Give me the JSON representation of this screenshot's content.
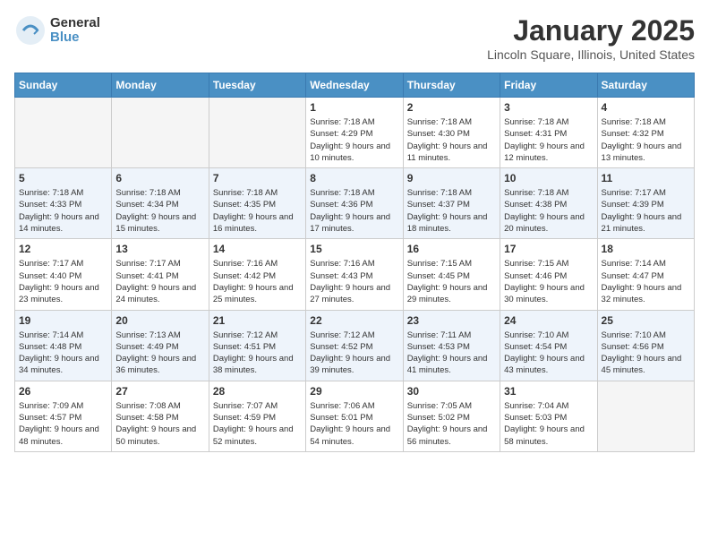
{
  "header": {
    "logo_general": "General",
    "logo_blue": "Blue",
    "month_title": "January 2025",
    "location": "Lincoln Square, Illinois, United States"
  },
  "weekdays": [
    "Sunday",
    "Monday",
    "Tuesday",
    "Wednesday",
    "Thursday",
    "Friday",
    "Saturday"
  ],
  "weeks": [
    {
      "alt": false,
      "days": [
        {
          "empty": true
        },
        {
          "empty": true
        },
        {
          "empty": true
        },
        {
          "num": "1",
          "sunrise": "7:18 AM",
          "sunset": "4:29 PM",
          "daylight": "9 hours and 10 minutes."
        },
        {
          "num": "2",
          "sunrise": "7:18 AM",
          "sunset": "4:30 PM",
          "daylight": "9 hours and 11 minutes."
        },
        {
          "num": "3",
          "sunrise": "7:18 AM",
          "sunset": "4:31 PM",
          "daylight": "9 hours and 12 minutes."
        },
        {
          "num": "4",
          "sunrise": "7:18 AM",
          "sunset": "4:32 PM",
          "daylight": "9 hours and 13 minutes."
        }
      ]
    },
    {
      "alt": true,
      "days": [
        {
          "num": "5",
          "sunrise": "7:18 AM",
          "sunset": "4:33 PM",
          "daylight": "9 hours and 14 minutes."
        },
        {
          "num": "6",
          "sunrise": "7:18 AM",
          "sunset": "4:34 PM",
          "daylight": "9 hours and 15 minutes."
        },
        {
          "num": "7",
          "sunrise": "7:18 AM",
          "sunset": "4:35 PM",
          "daylight": "9 hours and 16 minutes."
        },
        {
          "num": "8",
          "sunrise": "7:18 AM",
          "sunset": "4:36 PM",
          "daylight": "9 hours and 17 minutes."
        },
        {
          "num": "9",
          "sunrise": "7:18 AM",
          "sunset": "4:37 PM",
          "daylight": "9 hours and 18 minutes."
        },
        {
          "num": "10",
          "sunrise": "7:18 AM",
          "sunset": "4:38 PM",
          "daylight": "9 hours and 20 minutes."
        },
        {
          "num": "11",
          "sunrise": "7:17 AM",
          "sunset": "4:39 PM",
          "daylight": "9 hours and 21 minutes."
        }
      ]
    },
    {
      "alt": false,
      "days": [
        {
          "num": "12",
          "sunrise": "7:17 AM",
          "sunset": "4:40 PM",
          "daylight": "9 hours and 23 minutes."
        },
        {
          "num": "13",
          "sunrise": "7:17 AM",
          "sunset": "4:41 PM",
          "daylight": "9 hours and 24 minutes."
        },
        {
          "num": "14",
          "sunrise": "7:16 AM",
          "sunset": "4:42 PM",
          "daylight": "9 hours and 25 minutes."
        },
        {
          "num": "15",
          "sunrise": "7:16 AM",
          "sunset": "4:43 PM",
          "daylight": "9 hours and 27 minutes."
        },
        {
          "num": "16",
          "sunrise": "7:15 AM",
          "sunset": "4:45 PM",
          "daylight": "9 hours and 29 minutes."
        },
        {
          "num": "17",
          "sunrise": "7:15 AM",
          "sunset": "4:46 PM",
          "daylight": "9 hours and 30 minutes."
        },
        {
          "num": "18",
          "sunrise": "7:14 AM",
          "sunset": "4:47 PM",
          "daylight": "9 hours and 32 minutes."
        }
      ]
    },
    {
      "alt": true,
      "days": [
        {
          "num": "19",
          "sunrise": "7:14 AM",
          "sunset": "4:48 PM",
          "daylight": "9 hours and 34 minutes."
        },
        {
          "num": "20",
          "sunrise": "7:13 AM",
          "sunset": "4:49 PM",
          "daylight": "9 hours and 36 minutes."
        },
        {
          "num": "21",
          "sunrise": "7:12 AM",
          "sunset": "4:51 PM",
          "daylight": "9 hours and 38 minutes."
        },
        {
          "num": "22",
          "sunrise": "7:12 AM",
          "sunset": "4:52 PM",
          "daylight": "9 hours and 39 minutes."
        },
        {
          "num": "23",
          "sunrise": "7:11 AM",
          "sunset": "4:53 PM",
          "daylight": "9 hours and 41 minutes."
        },
        {
          "num": "24",
          "sunrise": "7:10 AM",
          "sunset": "4:54 PM",
          "daylight": "9 hours and 43 minutes."
        },
        {
          "num": "25",
          "sunrise": "7:10 AM",
          "sunset": "4:56 PM",
          "daylight": "9 hours and 45 minutes."
        }
      ]
    },
    {
      "alt": false,
      "days": [
        {
          "num": "26",
          "sunrise": "7:09 AM",
          "sunset": "4:57 PM",
          "daylight": "9 hours and 48 minutes."
        },
        {
          "num": "27",
          "sunrise": "7:08 AM",
          "sunset": "4:58 PM",
          "daylight": "9 hours and 50 minutes."
        },
        {
          "num": "28",
          "sunrise": "7:07 AM",
          "sunset": "4:59 PM",
          "daylight": "9 hours and 52 minutes."
        },
        {
          "num": "29",
          "sunrise": "7:06 AM",
          "sunset": "5:01 PM",
          "daylight": "9 hours and 54 minutes."
        },
        {
          "num": "30",
          "sunrise": "7:05 AM",
          "sunset": "5:02 PM",
          "daylight": "9 hours and 56 minutes."
        },
        {
          "num": "31",
          "sunrise": "7:04 AM",
          "sunset": "5:03 PM",
          "daylight": "9 hours and 58 minutes."
        },
        {
          "empty": true
        }
      ]
    }
  ]
}
